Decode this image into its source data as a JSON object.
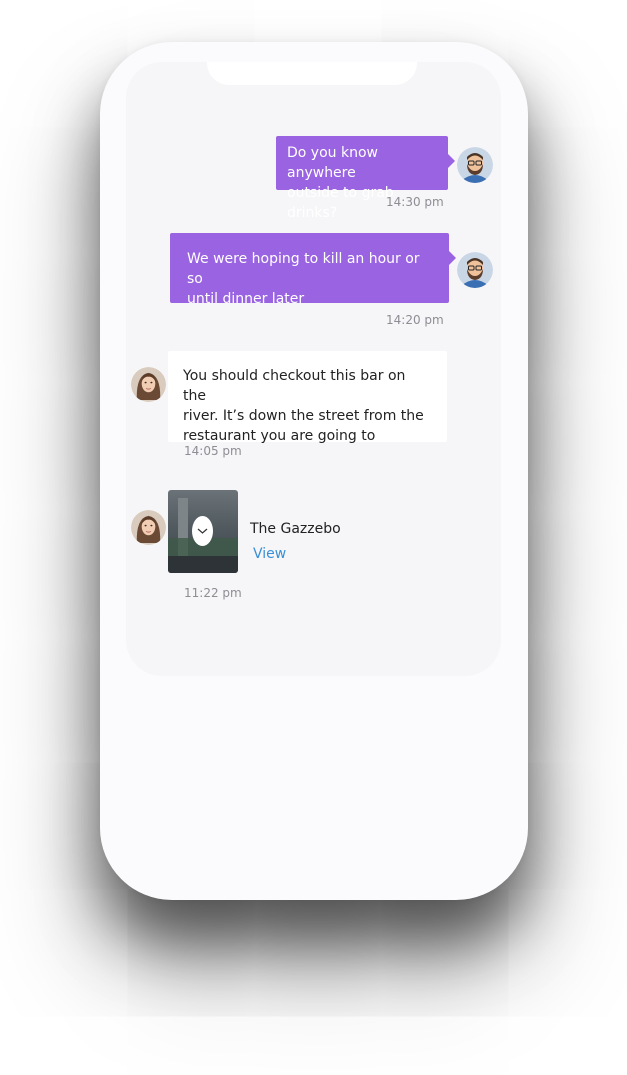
{
  "messages": [
    {
      "lines": [
        "Do you know anywhere",
        "outside to grab drinks?"
      ],
      "time": "14:30 pm",
      "sender": "me"
    },
    {
      "lines": [
        "We were hoping to kill an hour or so",
        "until dinner later"
      ],
      "time": "14:20 pm",
      "sender": "me"
    },
    {
      "lines": [
        "You should checkout this bar on the",
        "river. It’s down the street from the",
        "restaurant you are going to"
      ],
      "time": "14:05 pm",
      "sender": "contact"
    }
  ],
  "location_card": {
    "name": "The Gazzebo",
    "link_label": "View",
    "time": "11:22 pm",
    "icon": "chevron-down-icon"
  },
  "colors": {
    "outgoing_bubble": "#9a63e1",
    "incoming_bubble": "#ffffff",
    "link": "#3a8fd4",
    "timestamp": "#8d8d93"
  }
}
